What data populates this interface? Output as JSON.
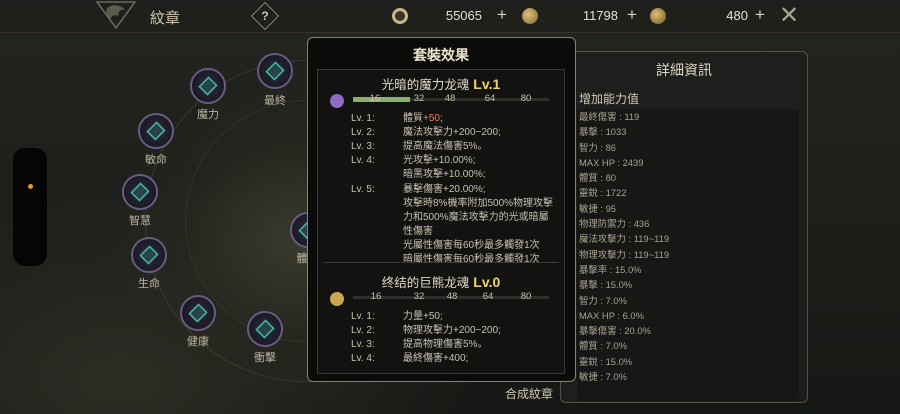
{
  "topbar": {
    "title": "紋章",
    "help_icon": "?",
    "currencies": [
      {
        "name": "gear-coin",
        "value": "55065",
        "color": "#c8b78a"
      },
      {
        "name": "gold-pouch",
        "value": "11798",
        "color": "#b99a4c"
      },
      {
        "name": "bronze-coin",
        "value": "480",
        "color": "#c7a35c"
      }
    ],
    "close_icon": "✕"
  },
  "emblems": {
    "nodes": [
      "魔力",
      "最終",
      "敏命",
      "智慧",
      "生命",
      "健康",
      "衝擊",
      "體"
    ]
  },
  "set_effect": {
    "title": "套裝效果",
    "sets": [
      {
        "name": "光暗的魔力龙魂",
        "level": "Lv.1",
        "icon_color": "#8e6bc4",
        "ticks": [
          "16",
          "32",
          "48",
          "64",
          "80"
        ],
        "progress": 0.29,
        "lines": [
          {
            "lv": "Lv. 1:",
            "text": "體質",
            "highlight": "+50",
            "rest": ";"
          },
          {
            "lv": "Lv. 2:",
            "text": "魔法攻擊力+200~200;"
          },
          {
            "lv": "Lv. 3:",
            "text": "提高魔法傷害5%。"
          },
          {
            "lv": "Lv. 4:",
            "text": "光攻擊+10.00%;"
          },
          {
            "lv": "",
            "text": "暗黑攻擊+10.00%;"
          },
          {
            "lv": "Lv. 5:",
            "text": "暴擊傷害+20.00%;"
          },
          {
            "lv": "",
            "text": "攻擊時8%機率附加500%物理攻擊"
          },
          {
            "lv": "",
            "text": "力和500%魔法攻擊力的光或暗屬"
          },
          {
            "lv": "",
            "text": "性傷害"
          },
          {
            "lv": "",
            "text": "光屬性傷害每60秒最多觸發1次"
          },
          {
            "lv": "",
            "text": "暗屬性傷害每60秒最多觸發1次"
          }
        ]
      },
      {
        "name": "终结的巨熊龙魂",
        "level": "Lv.0",
        "icon_color": "#c9a852",
        "ticks": [
          "16",
          "32",
          "48",
          "64",
          "80"
        ],
        "progress": 0,
        "lines": [
          {
            "lv": "Lv. 1:",
            "text": "力量+50;"
          },
          {
            "lv": "Lv. 2:",
            "text": "物理攻擊力+200~200;"
          },
          {
            "lv": "Lv. 3:",
            "text": "提高物理傷害5%。"
          },
          {
            "lv": "Lv. 4:",
            "text": "最終傷害+400;"
          }
        ]
      }
    ]
  },
  "detail": {
    "title": "詳細資訊",
    "subtitle": "增加能力值",
    "stats": [
      "最終傷害 : 119",
      "暴擊 : 1033",
      "智力 : 86",
      "MAX HP : 2439",
      "體質 : 80",
      "靈銳 : 1722",
      "敏捷 : 95",
      "物理防禦力 : 436",
      "魔法攻擊力 : 119~119",
      "物理攻擊力 : 119~119",
      "暴擊率 : 15.0%",
      "暴擊 : 15.0%",
      "智力 : 7.0%",
      "MAX HP : 6.0%",
      "暴擊傷害 : 20.0%",
      "體質 : 7.0%",
      "靈銳 : 15.0%",
      "敏捷 : 7.0%"
    ]
  },
  "craft_label": "合成紋章"
}
